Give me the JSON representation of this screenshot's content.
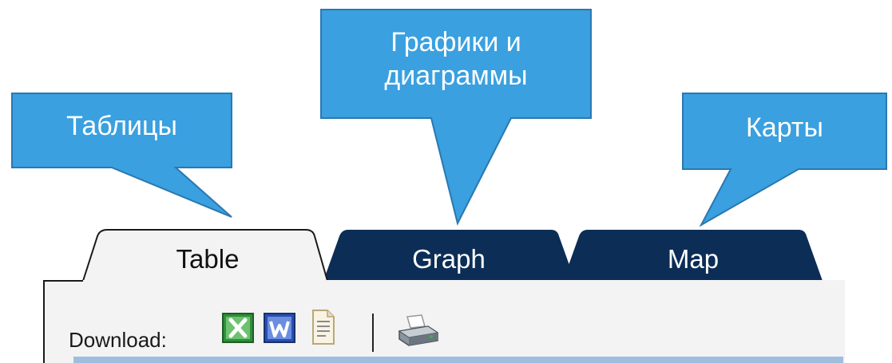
{
  "callouts": [
    {
      "id": "tables",
      "text": "Таблицы"
    },
    {
      "id": "graphs",
      "line1": "Графики и",
      "line2": "диаграммы"
    },
    {
      "id": "maps",
      "text": "Карты"
    }
  ],
  "tabs": [
    {
      "id": "table",
      "label": "Table",
      "active": true
    },
    {
      "id": "graph",
      "label": "Graph",
      "active": false
    },
    {
      "id": "map",
      "label": "Map",
      "active": false
    }
  ],
  "toolbar": {
    "download_label": "Download:",
    "icons": [
      "excel-icon",
      "word-icon",
      "text-file-icon",
      "print-icon"
    ]
  },
  "colors": {
    "callout_fill": "#3aa0e0",
    "callout_border": "#2a78b0",
    "tab_inactive": "#0c2d55",
    "tab_active": "#f3f3f3",
    "panel": "#f3f3f3",
    "bottom_bar": "#9fbedf"
  }
}
